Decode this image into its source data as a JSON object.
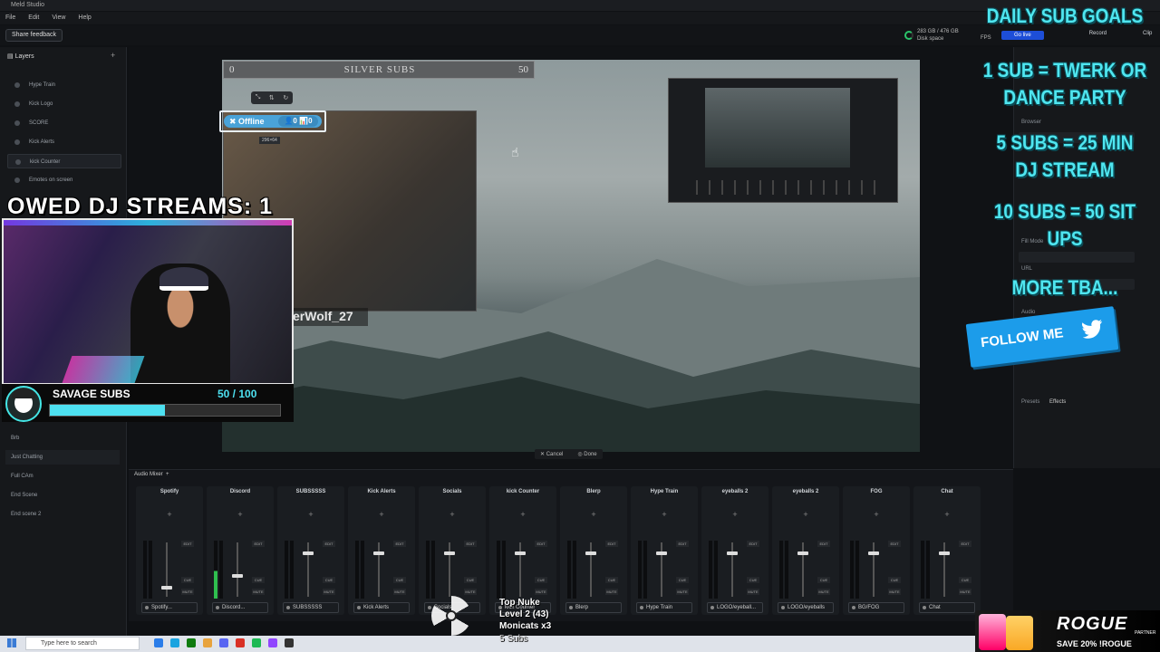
{
  "app": {
    "title": "Meld Studio",
    "menu": [
      "File",
      "Edit",
      "View",
      "Help"
    ],
    "feedback_label": "Share feedback"
  },
  "status": {
    "disk_used": "283 GB / 476 GB",
    "disk_label": "Disk space",
    "fps_label": "FPS",
    "go_live": "Go live",
    "record": "Record",
    "clip": "Clip"
  },
  "layers": {
    "title": "Layers",
    "items": [
      "Hype Train",
      "Kick Logo",
      "SCORE",
      "Kick Alerts",
      "kick Counter",
      "Emotes on screen"
    ]
  },
  "scenes": [
    "Brb",
    "Just Chatting",
    "Full CAm",
    "End Scene",
    "End scene 2"
  ],
  "canvas": {
    "silver_label": "SILVER SUBS",
    "silver_min": "0",
    "silver_max": "50",
    "offline_label": "✖ Offline",
    "offline_counts": "👤0  📊0",
    "size_tag": "296×64",
    "username": "erWolf_27",
    "cancel": "✕ Cancel",
    "done": "◎ Done"
  },
  "right_panel": {
    "browser": "Browser",
    "fill_mode": "Fill Mode",
    "url": "URL",
    "audio": "Audio",
    "presets": "Presets",
    "effects": "Effects"
  },
  "mixer": {
    "title": "Audio Mixer",
    "channels": [
      {
        "name": "Spotify",
        "source": "Spotify..."
      },
      {
        "name": "Discord",
        "source": "Discord..."
      },
      {
        "name": "SUBSSSSS",
        "source": "SUBSSSSS"
      },
      {
        "name": "Kick Alerts",
        "source": "Kick Alerts"
      },
      {
        "name": "Socials",
        "source": "Socials"
      },
      {
        "name": "kick Counter",
        "source": "kick Counter"
      },
      {
        "name": "Blerp",
        "source": "Blerp"
      },
      {
        "name": "Hype Train",
        "source": "Hype Train"
      },
      {
        "name": "eyeballs 2",
        "source": "LOGO/eyeball..."
      },
      {
        "name": "eyeballs 2",
        "source": "LOGO/eyeballs"
      },
      {
        "name": "FOG",
        "source": "BG/FOG"
      },
      {
        "name": "Chat",
        "source": "Chat"
      }
    ],
    "edit": "EDIT",
    "cue": "CUE",
    "mute": "MUTE"
  },
  "taskbar": {
    "search_placeholder": "Type here to search"
  },
  "overlay": {
    "owed": "OWED DJ STREAMS: 1",
    "sub_title": "SAVAGE SUBS",
    "sub_count": "50  / 100",
    "sub_progress": 0.5,
    "goals": [
      "DAILY SUB GOALS",
      "1 SUB = TWERK OR",
      "DANCE PARTY",
      "5 SUBS = 25 MIN",
      "DJ STREAM",
      "10 SUBS = 50 SIT",
      "UPS",
      "MORE TBA..."
    ],
    "follow": "FOLLOW ME",
    "alert_lines": [
      "Top Nuke",
      "Level 2  (43)",
      "Monicats x3",
      "5 Subs"
    ],
    "sponsor_brand": "ROGUE",
    "sponsor_partner": "PARTNER",
    "sponsor_offer": "SAVE 20% !ROGUE"
  },
  "colors": {
    "accent": "#4de0f0",
    "twitter": "#1c9cea",
    "go_live": "#1d4ed8"
  }
}
